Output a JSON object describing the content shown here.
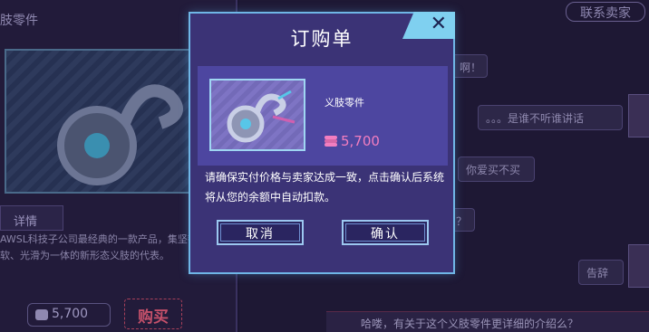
{
  "background": {
    "left_panel": {
      "item_title": "肢零件",
      "detail_tab": "详情",
      "description": "AWSL科技子公司最经典的一款产品，集坚韧、柔软、光滑为一体的新形态义肢的代表。",
      "price": "5,700",
      "buy_label": "购买"
    },
    "right_panel": {
      "contact_label": "联系卖家",
      "messages": [
        "啊！",
        "。。。是谁不听谁讲话",
        "你爱买不买",
        "？",
        "告辞"
      ],
      "bottom_prompt": "哈喽，有关于这个义肢零件更详细的介绍么？"
    }
  },
  "modal": {
    "title": "订购单",
    "close_icon": "close-x-icon",
    "item": {
      "name": "义肢零件",
      "price": "5,700",
      "currency_icon": "coin-stack-icon"
    },
    "message": "请确保实付价格与卖家达成一致，点击确认后系统将从您的余额中自动扣款。",
    "cancel_label": "取消",
    "confirm_label": "确认"
  },
  "colors": {
    "modal_bg": "#3b3376",
    "modal_border": "#6fb6e6",
    "price_pink": "#f27ec0",
    "close_button": "#7fd0f0"
  }
}
